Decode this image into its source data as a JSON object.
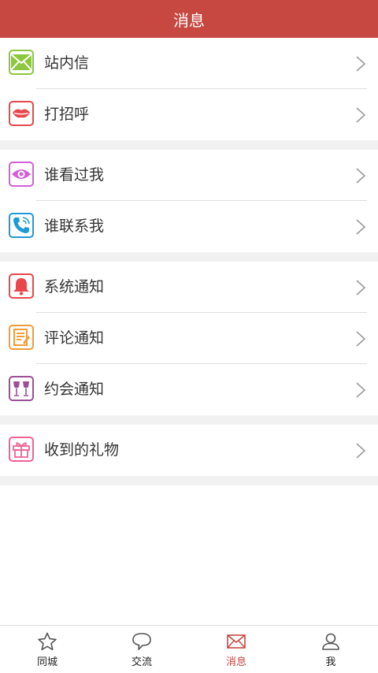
{
  "header": {
    "title": "消息"
  },
  "groups": [
    [
      {
        "label": "站内信",
        "icon": "mail-icon",
        "color": "#8dc63f"
      },
      {
        "label": "打招呼",
        "icon": "lips-icon",
        "color": "#e8474c"
      }
    ],
    [
      {
        "label": "谁看过我",
        "icon": "eye-icon",
        "color": "#d25fd6"
      },
      {
        "label": "谁联系我",
        "icon": "phone-icon",
        "color": "#1e9ad6"
      }
    ],
    [
      {
        "label": "系统通知",
        "icon": "bell-icon",
        "color": "#e8474c"
      },
      {
        "label": "评论通知",
        "icon": "note-icon",
        "color": "#f39c3a"
      },
      {
        "label": "约会通知",
        "icon": "wine-glasses-icon",
        "color": "#9b4f96"
      }
    ],
    [
      {
        "label": "收到的礼物",
        "icon": "gift-icon",
        "color": "#f06292"
      }
    ]
  ],
  "tabbar": {
    "tabs": [
      {
        "label": "同城",
        "icon": "star-icon"
      },
      {
        "label": "交流",
        "icon": "chat-bubble-icon"
      },
      {
        "label": "消息",
        "icon": "envelope-icon",
        "active": true
      },
      {
        "label": "我",
        "icon": "person-icon"
      }
    ],
    "active_color": "#c64841"
  }
}
